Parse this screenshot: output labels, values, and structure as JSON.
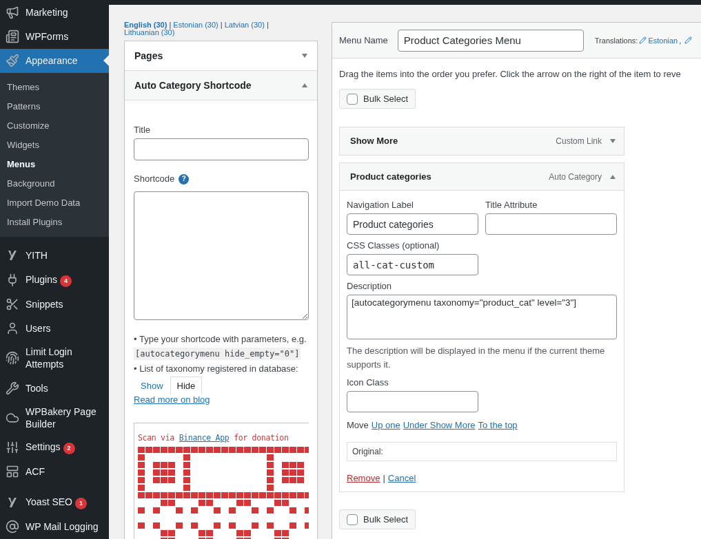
{
  "sidebar": {
    "items": [
      {
        "label": "Marketing",
        "selected": false
      },
      {
        "label": "WPForms",
        "selected": false
      },
      {
        "label": "Appearance",
        "selected": true,
        "children": [
          {
            "label": "Themes",
            "selected": false
          },
          {
            "label": "Patterns",
            "selected": false
          },
          {
            "label": "Customize",
            "selected": false
          },
          {
            "label": "Widgets",
            "selected": false
          },
          {
            "label": "Menus",
            "selected": true
          },
          {
            "label": "Background",
            "selected": false
          },
          {
            "label": "Import Demo Data",
            "selected": false
          },
          {
            "label": "Install Plugins",
            "selected": false
          }
        ]
      },
      {
        "label": "YITH",
        "selected": false
      },
      {
        "label": "Plugins",
        "selected": false,
        "badge": "4"
      },
      {
        "label": "Snippets",
        "selected": false
      },
      {
        "label": "Users",
        "selected": false
      },
      {
        "label": "Limit Login Attempts",
        "selected": false
      },
      {
        "label": "Tools",
        "selected": false
      },
      {
        "label": "WPBakery Page Builder",
        "selected": false
      },
      {
        "label": "Settings",
        "selected": false,
        "badge": "2"
      },
      {
        "label": "ACF",
        "selected": false
      },
      {
        "label": "Yoast SEO",
        "selected": false,
        "badge": "1"
      },
      {
        "label": "WP Mail Logging",
        "selected": false
      }
    ]
  },
  "add_items": {
    "languages": [
      {
        "label": "English (30)",
        "selected": true
      },
      {
        "label": "Estonian (30)",
        "selected": false
      },
      {
        "label": "Latvian (30)",
        "selected": false
      },
      {
        "label": "Lithuanian (30)",
        "selected": false
      }
    ],
    "language_separator": "|",
    "sections": [
      {
        "title": "Pages",
        "expanded": false
      },
      {
        "title": "Auto Category Shortcode",
        "expanded": true
      }
    ],
    "title_label": "Title",
    "shortcode_label": "Shortcode",
    "help_mark": "?",
    "hint_1": "• Type your shortcode with parameters, e.g.",
    "hint_code": "[autocategorymenu hide_empty=\"0\"]",
    "hint_2": "• List of taxonomy registered in database:",
    "toggle": [
      {
        "label": "Show",
        "selected": false
      },
      {
        "label": "Hide",
        "selected": true
      }
    ],
    "read_more": "Read more on blog",
    "donation": {
      "before": "Scan via",
      "link": "Binance App",
      "after": "for donation"
    }
  },
  "menu": {
    "name_label": "Menu Name",
    "name_value": "Product Categories Menu",
    "translations_label": "Translations:",
    "translations": [
      {
        "label": "Estonian"
      }
    ],
    "translation_separator": ",",
    "instructions": "Drag the items into the order you prefer. Click the arrow on the right of the item to reve",
    "bulk_select": {
      "label": "Bulk Select",
      "checked": false
    },
    "items": [
      {
        "title": "Show More",
        "type": "Custom Link",
        "expanded": false
      },
      {
        "title": "Product categories",
        "type": "Auto Category",
        "expanded": true,
        "nav_label": "Navigation Label",
        "nav_value": "Product categories",
        "title_attr": "Title Attribute",
        "css_label": "CSS Classes (optional)",
        "css_value": "all-cat-custom",
        "desc_label": "Description",
        "desc_value": "[autocategorymenu taxonomy=\"product_cat\" level=\"3\"]",
        "desc_hint": "The description will be displayed in the menu if the current theme supports it.",
        "icon_label": "Icon Class",
        "move_label": "Move",
        "move_links": [
          "Up one",
          "Under Show More",
          "To the top"
        ],
        "original": "Original:",
        "remove": "Remove",
        "separator": "|",
        "cancel": "Cancel"
      }
    ],
    "bulk_select_bottom": {
      "label": "Bulk Select",
      "checked": false
    }
  }
}
